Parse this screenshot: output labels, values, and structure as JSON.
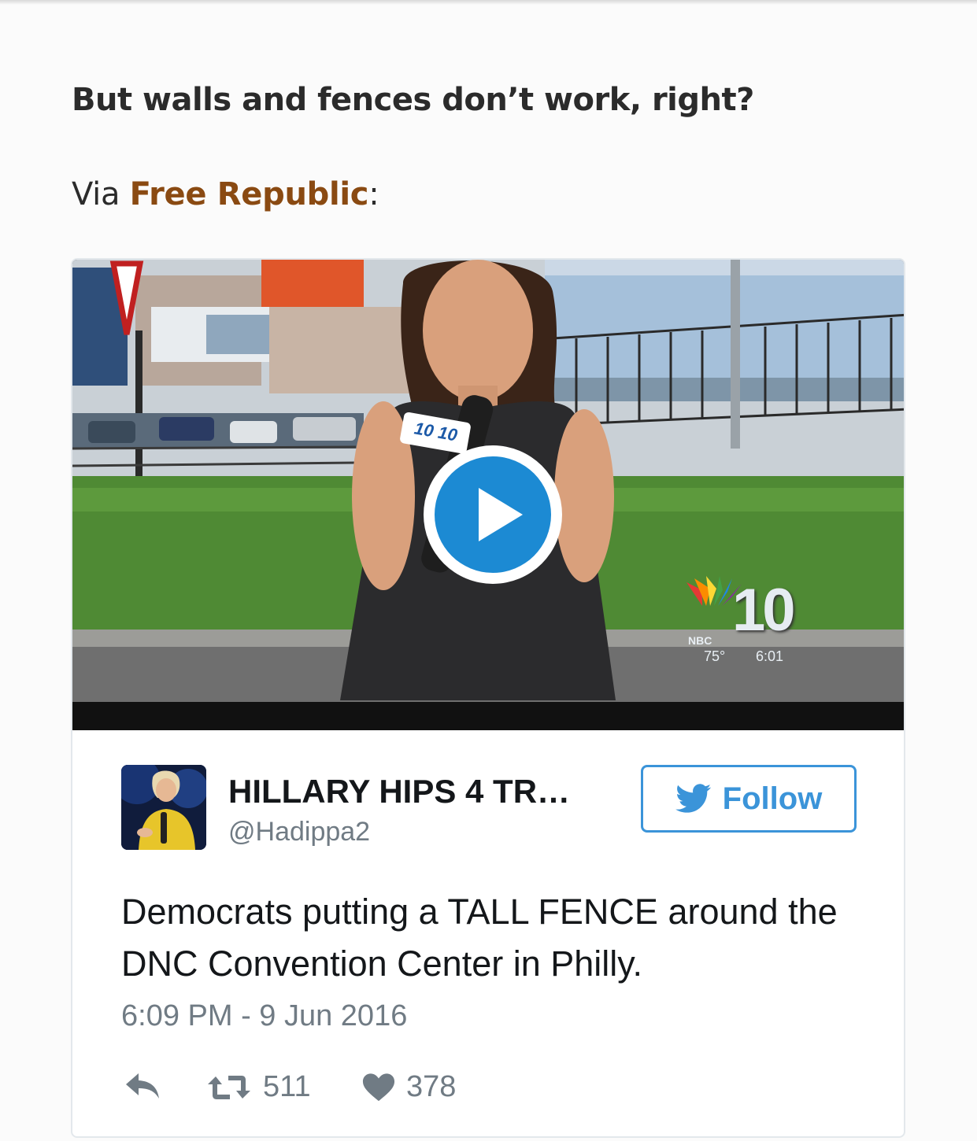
{
  "article": {
    "headline": "But walls and fences don’t work, right?",
    "via_prefix": "Via ",
    "via_link": "Free Republic",
    "via_suffix": ":"
  },
  "tweet": {
    "video": {
      "mic_flag_text": "10 10",
      "station_logo": "NBC",
      "station_number": "10",
      "temperature": "75°",
      "clock": "6:01"
    },
    "author": {
      "display_name": "HILLARY HIPS 4 TR…",
      "handle": "@Hadippa2"
    },
    "follow_label": "Follow",
    "text": "Democrats putting a TALL FENCE around the DNC Convention Center in Philly.",
    "timestamp": "6:09 PM - 9 Jun 2016",
    "retweet_count": "511",
    "like_count": "378"
  },
  "colors": {
    "link": "#8a4a12",
    "twitter_blue": "#3b94d9",
    "play_blue": "#1c8ad3",
    "muted_text": "#707b84"
  }
}
